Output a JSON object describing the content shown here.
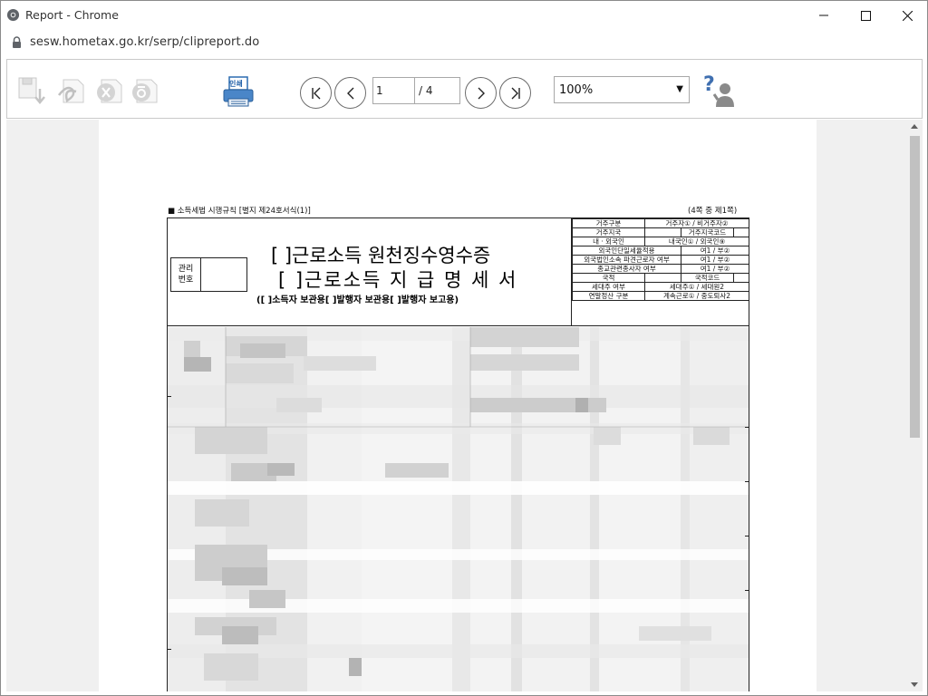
{
  "window": {
    "title": "Report - Chrome",
    "url": "sesw.hometax.go.kr/serp/clipreport.do"
  },
  "toolbar": {
    "page_current": "1",
    "page_total": "/ 4",
    "zoom_value": "100%",
    "icons": [
      "save-icon",
      "pdf-icon",
      "excel-icon",
      "hwp-icon",
      "print-icon",
      "first-page-icon",
      "prev-page-icon",
      "next-page-icon",
      "last-page-icon",
      "help-icon"
    ],
    "print_label": "인쇄"
  },
  "form": {
    "top_left": "■ 소득세법 시행규칙 [별지 제24호서식(1)]",
    "top_right": "(4쪽 중 제1쪽)",
    "management_label_1": "관리",
    "management_label_2": "번호",
    "title_1": "[  ]근로소득 원천징수영수증",
    "title_2": "[  ]근로소득 지 급 명 세 서",
    "copies": "([    ]소득자 보관용[    ]발행자 보관용[    ]발행자 보고용)",
    "info_rows": [
      [
        "거주구분",
        "거주자① / 비거주자②"
      ],
      [
        "거주지국",
        "",
        "거주지국코드",
        ""
      ],
      [
        "내 · 외국인",
        "내국인① / 외국인⑨"
      ],
      [
        "외국인단일세율적용",
        "여1 / 부②"
      ],
      [
        "외국법인소속 파견근로자 여부",
        "여1 / 부②"
      ],
      [
        "종교관련종사자 여부",
        "여1 / 부②"
      ],
      [
        "국적",
        "",
        "국적코드",
        ""
      ],
      [
        "세대주 여부",
        "세대주① / 세대원2"
      ],
      [
        "연말정산 구분",
        "계속근로① / 중도퇴사2"
      ]
    ]
  }
}
